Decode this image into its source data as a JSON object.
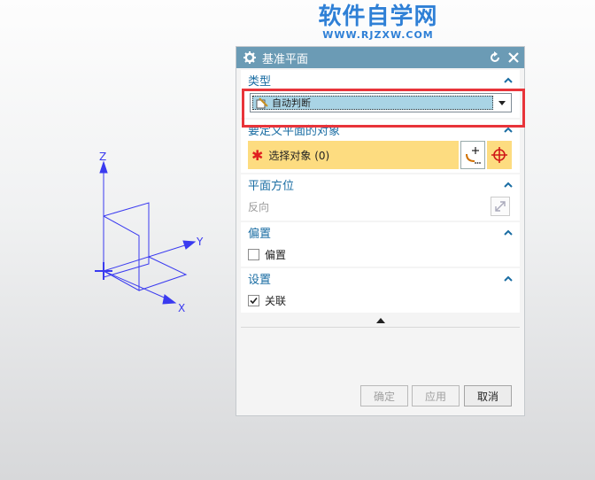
{
  "watermark": {
    "title": "软件自学网",
    "url": "WWW.RJZXW.COM"
  },
  "axes": {
    "z": "Z",
    "y": "Y",
    "x": "X"
  },
  "dialog": {
    "title": "基准平面",
    "sections": {
      "type": {
        "label": "类型",
        "selected": "自动判断"
      },
      "object": {
        "label": "要定义平面的对象",
        "select_text": "选择对象 (0)"
      },
      "orientation": {
        "label": "平面方位",
        "reverse": "反向"
      },
      "offset": {
        "label": "偏置",
        "checkbox": "偏置",
        "checked": false
      },
      "settings": {
        "label": "设置",
        "checkbox": "关联",
        "checked": true
      }
    },
    "buttons": {
      "ok": "确定",
      "apply": "应用",
      "cancel": "取消"
    }
  },
  "colors": {
    "titlebar": "#6b9bb5",
    "section_header": "#1a6da3",
    "highlight": "#e8343a",
    "select_fill": "#fddc80"
  }
}
